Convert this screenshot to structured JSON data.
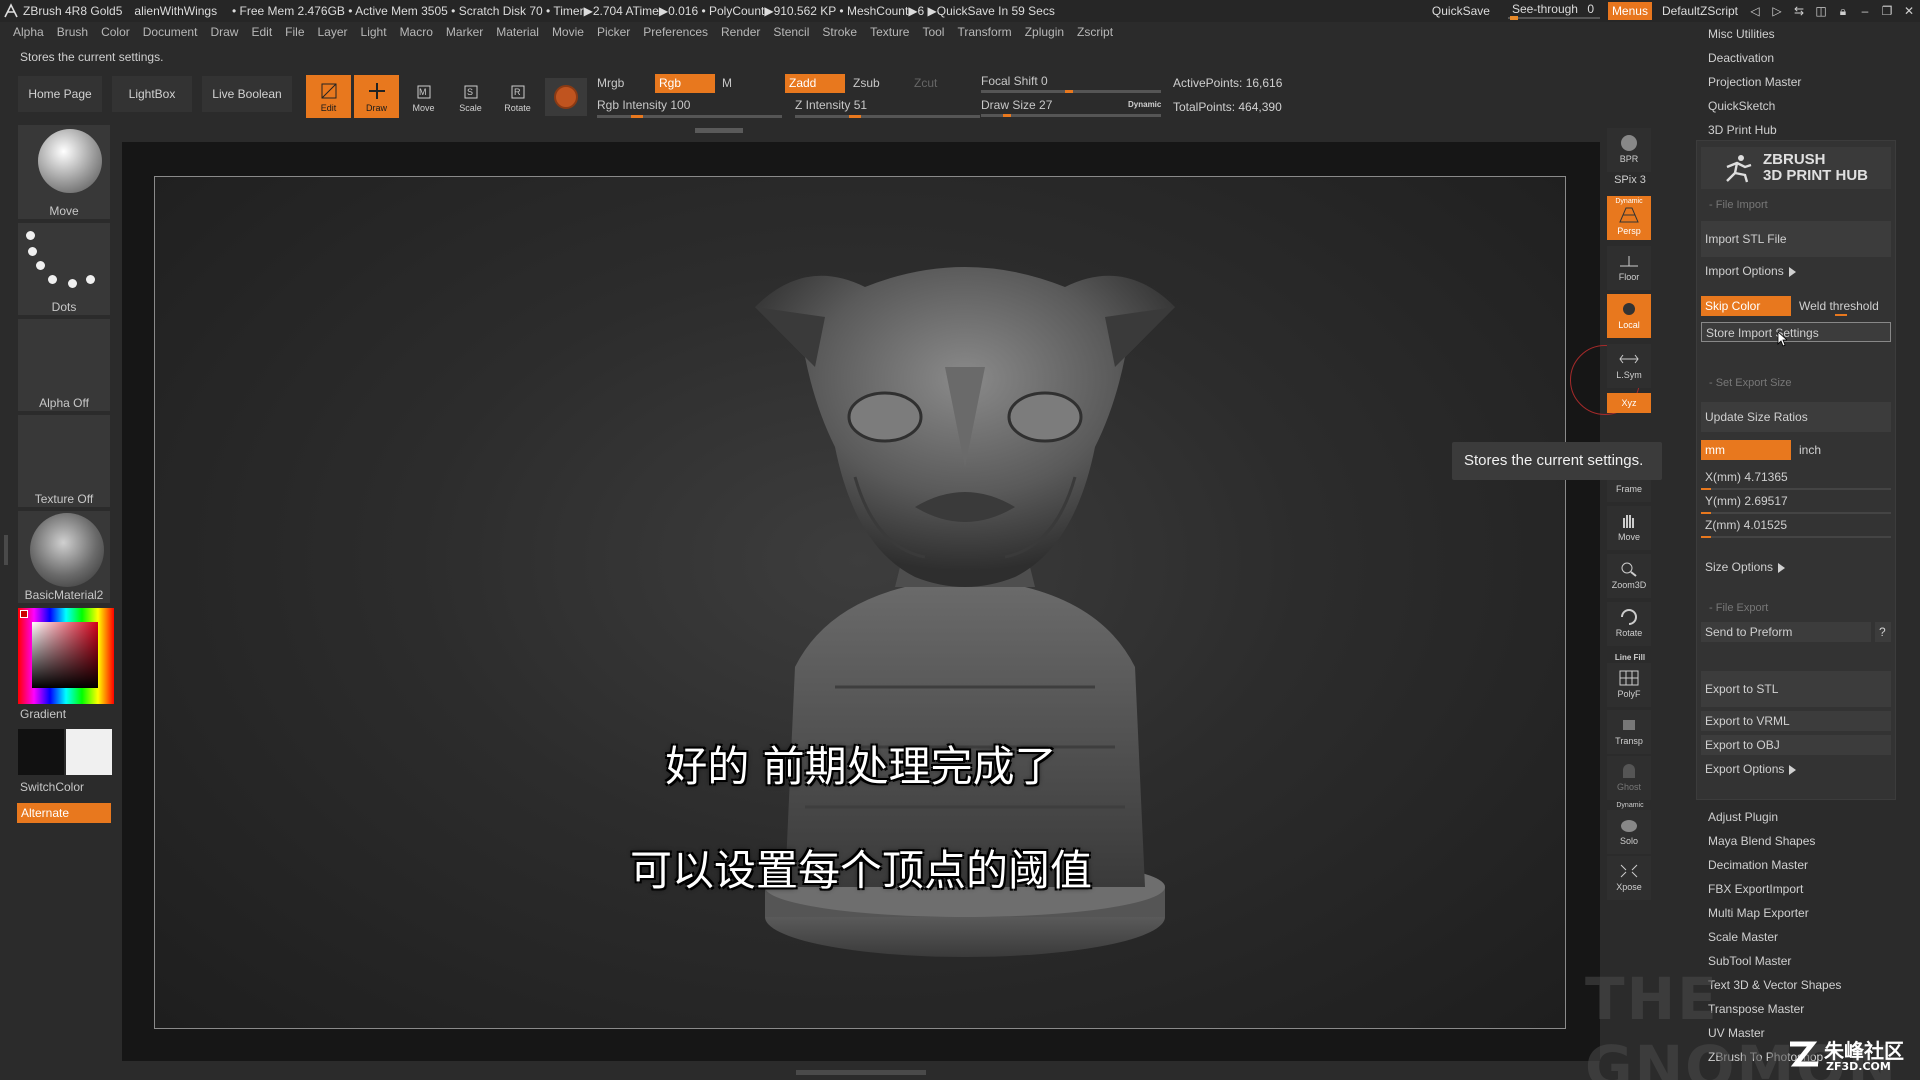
{
  "titlebar": {
    "app": "ZBrush 4R8 Gold5",
    "document": "alienWithWings",
    "info": "• Free Mem 2.476GB • Active Mem 3505 • Scratch Disk 70 • Timer▶2.704 ATime▶0.016 • PolyCount▶910.562 KP • MeshCount▶6 ▶QuickSave In 59 Secs",
    "quicksave": "QuickSave",
    "see_through": "See-through",
    "see_through_value": "0",
    "see_through_level": 0,
    "menus": "Menus",
    "default_zscript": "DefaultZScript"
  },
  "menubar": [
    "Alpha",
    "Brush",
    "Color",
    "Document",
    "Draw",
    "Edit",
    "File",
    "Layer",
    "Light",
    "Macro",
    "Marker",
    "Material",
    "Movie",
    "Picker",
    "Preferences",
    "Render",
    "Stencil",
    "Stroke",
    "Texture",
    "Tool",
    "Transform",
    "Zplugin",
    "Zscript"
  ],
  "status_text": "Stores the current settings.",
  "toolbar": {
    "home_page": "Home Page",
    "lightbox": "LightBox",
    "live_boolean": "Live Boolean",
    "tools": [
      {
        "label": "Edit",
        "icon": "edit-icon",
        "active": true
      },
      {
        "label": "Draw",
        "icon": "draw-icon",
        "active": true
      },
      {
        "label": "Move",
        "icon": "move-icon",
        "active": false
      },
      {
        "label": "Scale",
        "icon": "scale-icon",
        "active": false
      },
      {
        "label": "Rotate",
        "icon": "rotate-icon",
        "active": false
      }
    ],
    "mrgb": "Mrgb",
    "rgb": "Rgb",
    "m": "M",
    "zadd": "Zadd",
    "zsub": "Zsub",
    "zcut": "Zcut",
    "rgb_intensity": "Rgb Intensity 100",
    "z_intensity": "Z Intensity 51",
    "focal_shift": "Focal Shift 0",
    "draw_size": "Draw Size 27",
    "dynamic": "Dynamic",
    "active_points": "ActivePoints: 16,616",
    "total_points": "TotalPoints: 464,390",
    "rgb_intensity_value": 100,
    "z_intensity_value": 51
  },
  "left_shelf": {
    "move": "Move",
    "dots": "Dots",
    "alpha_off": "Alpha Off",
    "texture_off": "Texture Off",
    "material": "BasicMaterial2",
    "gradient": "Gradient",
    "switch_color": "SwitchColor",
    "alternate": "Alternate",
    "main_color": "#111111",
    "secondary_color": "#f0f0f0"
  },
  "right_shelf": {
    "bpr": "BPR",
    "spix": "SPix 3",
    "dynamic": "Dynamic",
    "persp": "Persp",
    "floor": "Floor",
    "local": "Local",
    "lsym": "L.Sym",
    "xyz": "Xyz",
    "frame": "Frame",
    "move": "Move",
    "zoom3d": "Zoom3D",
    "rotate": "Rotate",
    "line_fill": "Line Fill",
    "polyf": "PolyF",
    "transp": "Transp",
    "ghost": "Ghost",
    "dynamic2": "Dynamic",
    "solo": "Solo",
    "xpose": "Xpose"
  },
  "tray": {
    "top_items": [
      "Misc Utilities",
      "Deactivation",
      "Projection Master",
      "QuickSketch",
      "3D Print Hub"
    ],
    "hub_logo_line1": "ZBRUSH",
    "hub_logo_line2": "3D PRINT HUB",
    "file_import": "- File Import",
    "import_stl": "Import STL File",
    "import_options": "Import Options",
    "skip_color": "Skip Color",
    "weld_threshold": "Weld threshold",
    "store_import": "Store Import Settings",
    "set_export_size": "- Set Export Size",
    "update_size_ratios": "Update Size Ratios",
    "mm": "mm",
    "inch": "inch",
    "x": "X(mm) 4.71365",
    "y": "Y(mm) 2.69517",
    "z": "Z(mm) 4.01525",
    "size_options": "Size Options",
    "file_export": "- File Export",
    "send_to_preform": "Send to Preform",
    "help": "?",
    "export_stl": "Export to STL",
    "export_vrml": "Export to VRML",
    "export_obj": "Export to OBJ",
    "export_options": "Export Options",
    "bottom_items": [
      "Adjust Plugin",
      "Maya Blend Shapes",
      "Decimation Master",
      "FBX ExportImport",
      "Multi Map Exporter",
      "Scale Master",
      "SubTool Master",
      "Text 3D & Vector Shapes",
      "Transpose Master",
      "UV Master",
      "ZBrush To Photoshop"
    ]
  },
  "viewport": {
    "tooltip": "Stores the current settings.",
    "subtitle_1": "好的 前期处理完成了",
    "subtitle_2": "可以设置每个顶点的阈值"
  },
  "accent_color": "#e8781e"
}
